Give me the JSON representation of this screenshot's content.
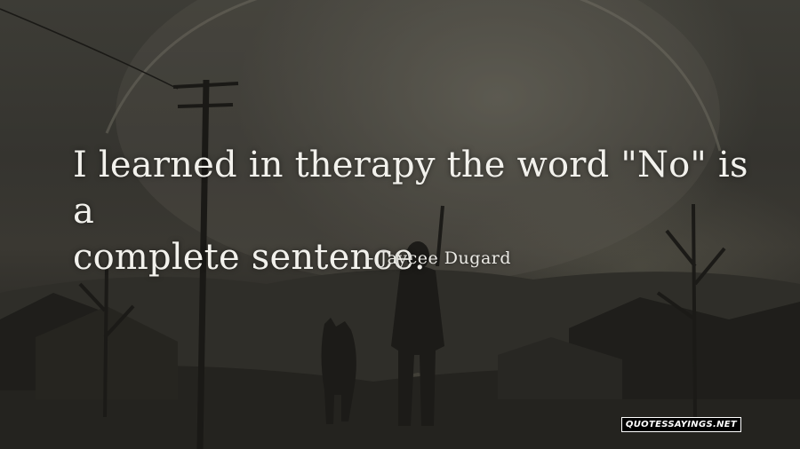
{
  "quote": {
    "line1": "I learned in therapy the word \"No\" is a",
    "line2": "complete sentence."
  },
  "author": "- Jaycee Dugard",
  "watermark": "QUOTESSAYINGS.NET"
}
